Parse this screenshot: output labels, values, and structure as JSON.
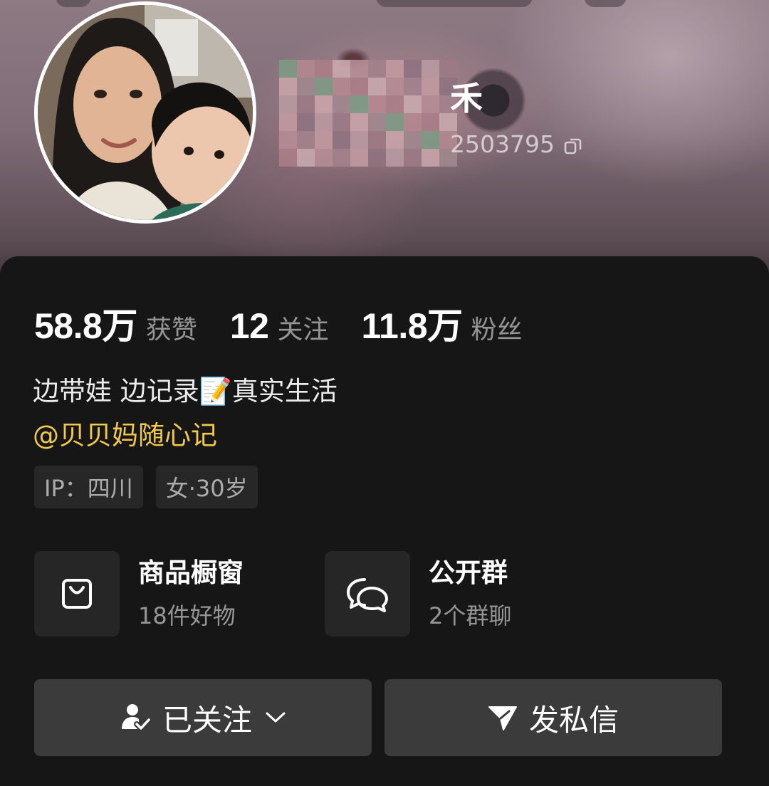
{
  "profile": {
    "name_visible": "禾",
    "id_visible": "2503795"
  },
  "stats": [
    {
      "value": "58.8万",
      "label": "获赞"
    },
    {
      "value": "12",
      "label": "关注"
    },
    {
      "value": "11.8万",
      "label": "粉丝"
    }
  ],
  "bio": {
    "line1": "边带娃 边记录📝真实生活",
    "mention": "@贝贝妈随心记"
  },
  "tags": [
    {
      "text": "IP：四川"
    },
    {
      "text": "女·30岁"
    }
  ],
  "entries": {
    "shop": {
      "title": "商品橱窗",
      "subtitle": "18件好物",
      "icon": "shopping-bag-icon"
    },
    "group": {
      "title": "公开群",
      "subtitle": "2个群聊",
      "icon": "chat-bubbles-icon"
    }
  },
  "actions": {
    "follow": {
      "label": "已关注",
      "icon": "user-check-icon",
      "dropdown_icon": "chevron-down-icon"
    },
    "message": {
      "label": "发私信",
      "icon": "send-icon"
    }
  },
  "colors": {
    "background": "#161616",
    "mention": "#f2c94a",
    "button": "#3b3b3b",
    "tag_background": "#272727"
  }
}
